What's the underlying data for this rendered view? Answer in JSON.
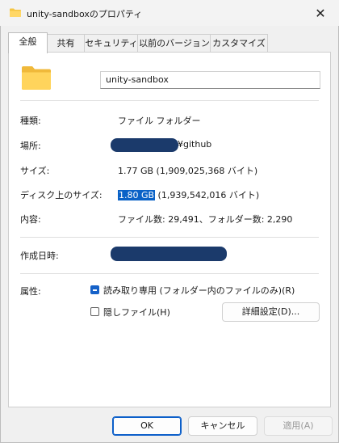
{
  "window": {
    "title": "unity-sandboxのプロパティ",
    "close_glyph": "✕"
  },
  "tabs": [
    {
      "label": "全般",
      "active": true
    },
    {
      "label": "共有",
      "active": false
    },
    {
      "label": "セキュリティ",
      "active": false
    },
    {
      "label": "以前のバージョン",
      "active": false
    },
    {
      "label": "カスタマイズ",
      "active": false
    }
  ],
  "general": {
    "name_value": "unity-sandbox",
    "type_label": "種類:",
    "type_value": "ファイル フォルダー",
    "location_label": "場所:",
    "location_suffix": "¥github",
    "size_label": "サイズ:",
    "size_value": "1.77 GB (1,909,025,368 バイト)",
    "disk_size_label": "ディスク上のサイズ:",
    "disk_size_highlight": "1.80 GB",
    "disk_size_rest": " (1,939,542,016 バイト)",
    "contents_label": "内容:",
    "contents_value": "ファイル数: 29,491、フォルダー数: 2,290",
    "created_label": "作成日時:",
    "attributes_label": "属性:",
    "readonly_label": "読み取り専用 (フォルダー内のファイルのみ)(R)",
    "hidden_label": "隠しファイル(H)",
    "advanced_button": "詳細設定(D)..."
  },
  "footer": {
    "ok": "OK",
    "cancel": "キャンセル",
    "apply": "適用(A)"
  },
  "colors": {
    "accent": "#0c5fc9",
    "redaction": "#1b3a6b",
    "folder": "#f5c542"
  }
}
